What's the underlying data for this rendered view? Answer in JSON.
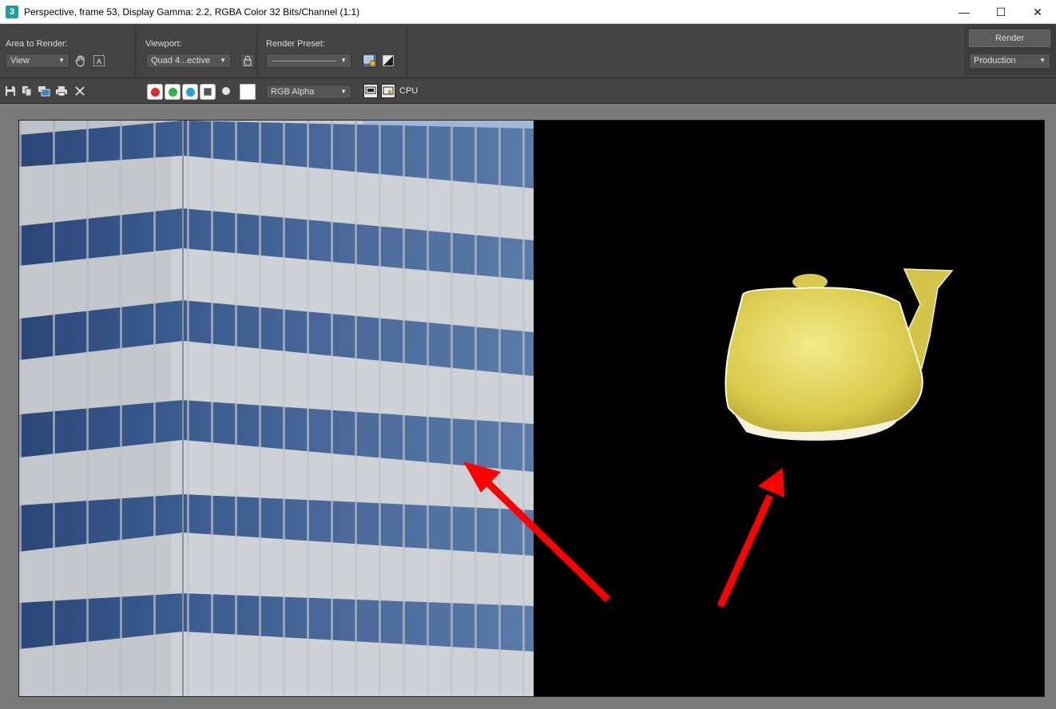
{
  "window": {
    "title": "Perspective, frame 53, Display Gamma: 2.2, RGBA Color 32 Bits/Channel (1:1)",
    "app_icon_text": "3",
    "minimize": "—",
    "maximize": "☐",
    "close": "✕"
  },
  "settings": {
    "area_label": "Area to Render:",
    "area_value": "View",
    "viewport_label": "Viewport:",
    "viewport_value": "Quad 4...ective",
    "preset_label": "Render Preset:",
    "preset_value": "",
    "render_button": "Render",
    "mode_value": "Production"
  },
  "toolbar": {
    "channel_display": "RGB Alpha",
    "cpu_label": "CPU",
    "channel_colors": {
      "red": "#e8262b",
      "green": "#2fb34a",
      "blue": "#1da1e0"
    }
  },
  "icons": {
    "save": "save-icon",
    "copy": "copy-icon",
    "clone": "clone-window-icon",
    "print": "print-icon",
    "clear": "clear-icon"
  }
}
